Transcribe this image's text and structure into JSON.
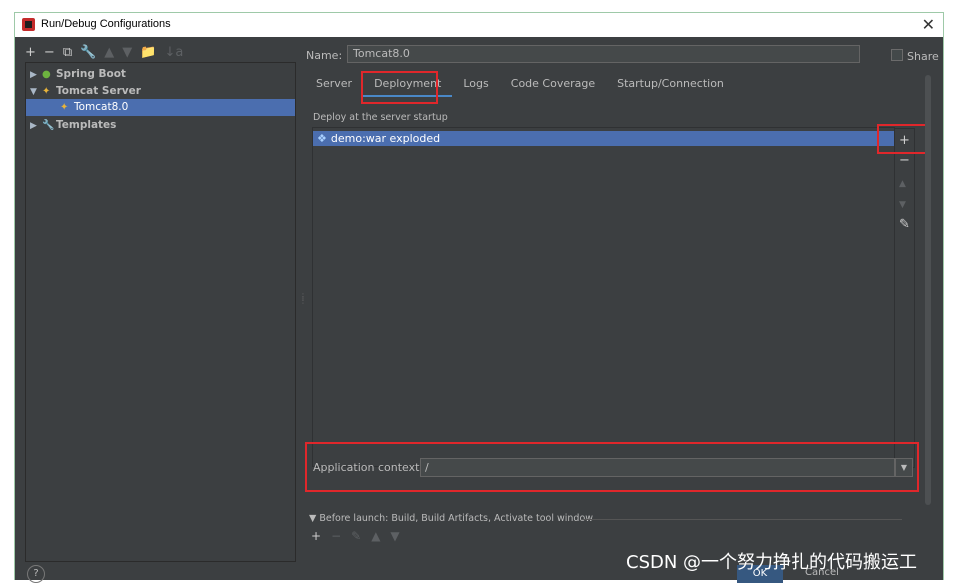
{
  "window": {
    "title": "Run/Debug Configurations"
  },
  "tree_toolbar": {
    "add": "+",
    "remove": "−",
    "copy": "⧉",
    "edit": "🔧",
    "up": "▲",
    "down": "▼",
    "folder": "📁",
    "sort": "↓a"
  },
  "tree": [
    {
      "label": "Spring Boot",
      "arrow": "▶",
      "level": 0
    },
    {
      "label": "Tomcat Server",
      "arrow": "▼",
      "level": 0
    },
    {
      "label": "Tomcat8.0",
      "arrow": "",
      "level": 1,
      "selected": true
    },
    {
      "label": "Templates",
      "arrow": "▶",
      "level": 0
    }
  ],
  "name_label": "Name:",
  "name_value": "Tomcat8.0",
  "share_label": "Share",
  "tabs": [
    "Server",
    "Deployment",
    "Logs",
    "Code Coverage",
    "Startup/Connection"
  ],
  "active_tab": "Deployment",
  "deploy": {
    "header": "Deploy at the server startup",
    "items": [
      "demo:war exploded"
    ]
  },
  "side_buttons": {
    "add": "+",
    "remove": "−",
    "up": "▲",
    "down": "▼",
    "edit": "✎"
  },
  "app_context": {
    "label": "Application context:",
    "value": "/"
  },
  "before_launch": {
    "text": "Before launch: Build, Build Artifacts, Activate tool window"
  },
  "footer": {
    "help": "?",
    "ok": "OK",
    "cancel": "Cancel"
  },
  "watermark": "CSDN @一个努力挣扎的代码搬运工",
  "colors": {
    "background": "#3c3f41",
    "selection": "#4b6eaf",
    "highlight": "#e0272b"
  }
}
